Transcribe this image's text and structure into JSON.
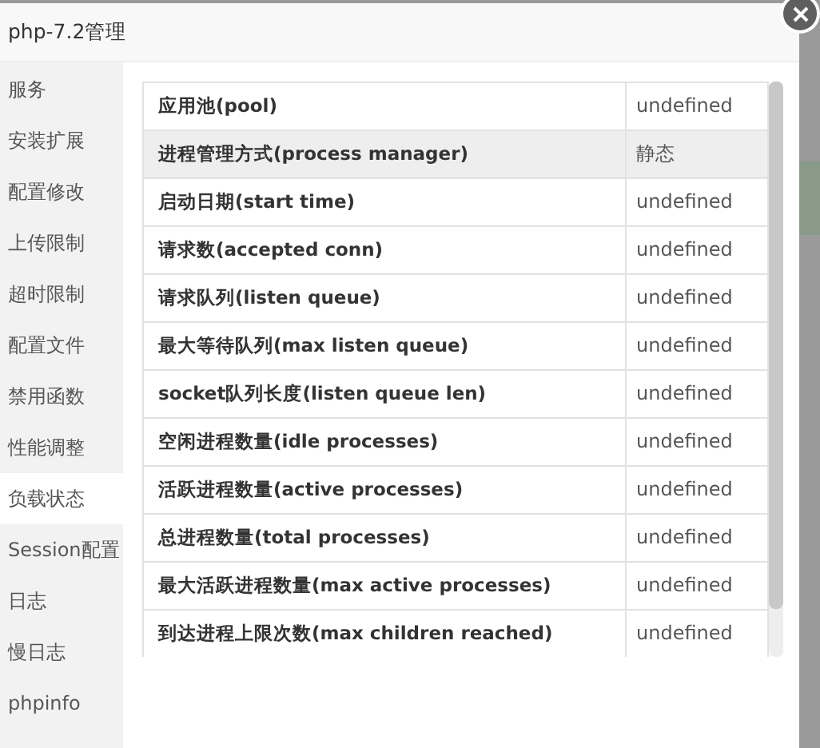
{
  "window": {
    "title": "php-7.2管理"
  },
  "sidebar": {
    "items": [
      {
        "label": "服务",
        "selected": false
      },
      {
        "label": "安装扩展",
        "selected": false
      },
      {
        "label": "配置修改",
        "selected": false
      },
      {
        "label": "上传限制",
        "selected": false
      },
      {
        "label": "超时限制",
        "selected": false
      },
      {
        "label": "配置文件",
        "selected": false
      },
      {
        "label": "禁用函数",
        "selected": false
      },
      {
        "label": "性能调整",
        "selected": false
      },
      {
        "label": "负载状态",
        "selected": true
      },
      {
        "label": "Session配置",
        "selected": false
      },
      {
        "label": "日志",
        "selected": false
      },
      {
        "label": "慢日志",
        "selected": false
      },
      {
        "label": "phpinfo",
        "selected": false
      }
    ]
  },
  "table": {
    "rows": [
      {
        "name": "应用池(pool)",
        "value": "undefined",
        "highlighted": false
      },
      {
        "name": "进程管理方式(process manager)",
        "value": "静态",
        "highlighted": true
      },
      {
        "name": "启动日期(start time)",
        "value": "undefined",
        "highlighted": false
      },
      {
        "name": "请求数(accepted conn)",
        "value": "undefined",
        "highlighted": false
      },
      {
        "name": "请求队列(listen queue)",
        "value": "undefined",
        "highlighted": false
      },
      {
        "name": "最大等待队列(max listen queue)",
        "value": "undefined",
        "highlighted": false
      },
      {
        "name": "socket队列长度(listen queue len)",
        "value": "undefined",
        "highlighted": false
      },
      {
        "name": "空闲进程数量(idle processes)",
        "value": "undefined",
        "highlighted": false
      },
      {
        "name": "活跃进程数量(active processes)",
        "value": "undefined",
        "highlighted": false
      },
      {
        "name": "总进程数量(total processes)",
        "value": "undefined",
        "highlighted": false
      },
      {
        "name": "最大活跃进程数量(max active processes)",
        "value": "undefined",
        "highlighted": false
      },
      {
        "name": "到达进程上限次数(max children reached)",
        "value": "undefined",
        "highlighted": false
      }
    ]
  }
}
